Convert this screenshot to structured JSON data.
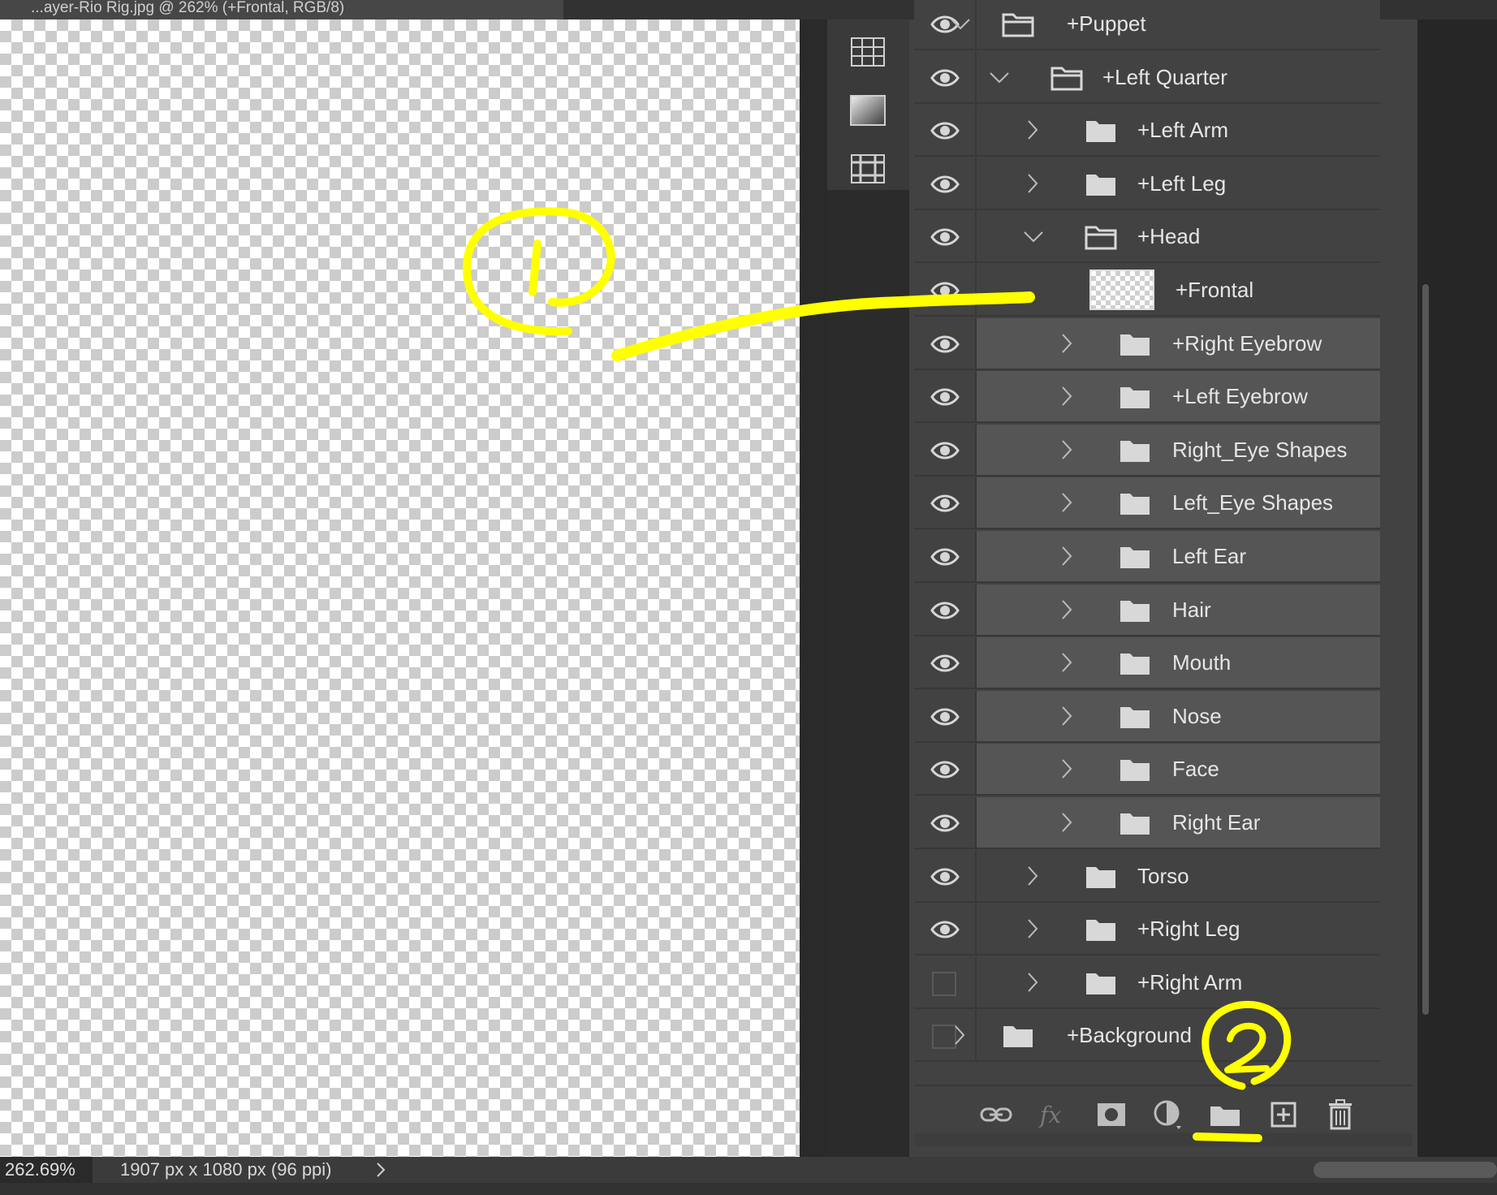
{
  "document_tab": {
    "title": "...ayer-Rio Rig.jpg @ 262% (+Frontal, RGB/8)"
  },
  "toolbar": {
    "icons": [
      "grid-icon",
      "gradient-swatch-icon",
      "grid-pattern-icon"
    ]
  },
  "layers": [
    {
      "name": "+Puppet",
      "visible": true,
      "expanded": true,
      "depth": 0
    },
    {
      "name": "+Left Quarter",
      "visible": true,
      "expanded": true,
      "depth": 1
    },
    {
      "name": "+Left Arm",
      "visible": true,
      "expanded": false,
      "depth": 2
    },
    {
      "name": "+Left Leg",
      "visible": true,
      "expanded": false,
      "depth": 2
    },
    {
      "name": "+Head",
      "visible": true,
      "expanded": true,
      "depth": 2
    },
    {
      "name": "+Frontal",
      "visible": true,
      "type": "pixel-layer",
      "depth": 3
    },
    {
      "name": "+Right Eyebrow",
      "visible": true,
      "expanded": false,
      "depth": 3
    },
    {
      "name": "+Left Eyebrow",
      "visible": true,
      "expanded": false,
      "depth": 3
    },
    {
      "name": "Right_Eye Shapes",
      "visible": true,
      "expanded": false,
      "depth": 3
    },
    {
      "name": "Left_Eye Shapes",
      "visible": true,
      "expanded": false,
      "depth": 3
    },
    {
      "name": "Left Ear",
      "visible": true,
      "expanded": false,
      "depth": 3
    },
    {
      "name": "Hair",
      "visible": true,
      "expanded": false,
      "depth": 3
    },
    {
      "name": "Mouth",
      "visible": true,
      "expanded": false,
      "depth": 3
    },
    {
      "name": "Nose",
      "visible": true,
      "expanded": false,
      "depth": 3
    },
    {
      "name": "Face",
      "visible": true,
      "expanded": false,
      "depth": 3
    },
    {
      "name": "Right Ear",
      "visible": true,
      "expanded": false,
      "depth": 3
    },
    {
      "name": "Torso",
      "visible": true,
      "expanded": false,
      "depth": 2
    },
    {
      "name": "+Right Leg",
      "visible": true,
      "expanded": false,
      "depth": 2
    },
    {
      "name": "+Right Arm",
      "visible": false,
      "expanded": false,
      "depth": 2
    },
    {
      "name": "+Background",
      "visible": false,
      "expanded": false,
      "depth": 0
    }
  ],
  "panel_buttons": [
    "link-layers-icon",
    "fx-icon",
    "layer-mask-icon",
    "adjustment-layer-icon",
    "new-group-icon",
    "new-layer-icon",
    "trash-icon"
  ],
  "status": {
    "zoom": "262.69%",
    "doc_size": "1907 px x 1080 px (96 ppi)"
  },
  "annotation_color": "#ffff00"
}
